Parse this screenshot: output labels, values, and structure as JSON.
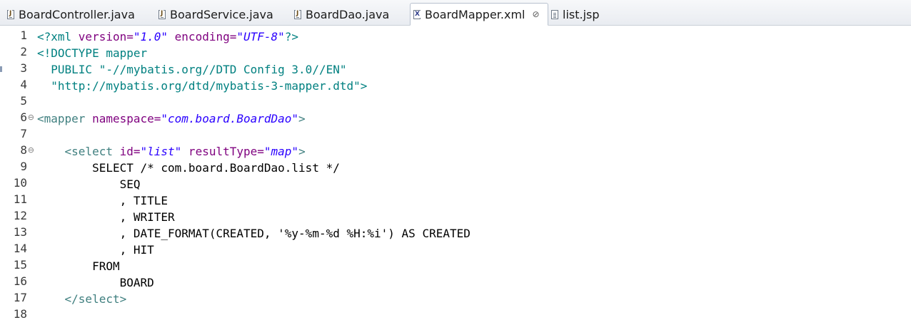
{
  "tabs": [
    {
      "label": "BoardController.java",
      "icon": "java-file-icon",
      "active": false
    },
    {
      "label": "BoardService.java",
      "icon": "java-file-icon",
      "active": false
    },
    {
      "label": "BoardDao.java",
      "icon": "java-file-icon",
      "active": false
    },
    {
      "label": "BoardMapper.xml",
      "icon": "xml-file-icon",
      "active": true,
      "close": "⊘"
    },
    {
      "label": "list.jsp",
      "icon": "jsp-file-icon",
      "active": false
    }
  ],
  "editor": {
    "line_numbers": [
      "1",
      "2",
      "3",
      "4",
      "5",
      "6",
      "7",
      "8",
      "9",
      "10",
      "11",
      "12",
      "13",
      "14",
      "15",
      "16",
      "17",
      "18"
    ],
    "fold_marker": "⊖",
    "lines": [
      [
        {
          "t": "<?xml ",
          "c": "decl"
        },
        {
          "t": "version=",
          "c": "attr"
        },
        {
          "t": "\"1.0\"",
          "c": "value"
        },
        {
          "t": " encoding=",
          "c": "attr"
        },
        {
          "t": "\"UTF-8\"",
          "c": "value"
        },
        {
          "t": "?>",
          "c": "decl"
        }
      ],
      [
        {
          "t": "<!DOCTYPE mapper",
          "c": "doctype"
        }
      ],
      [
        {
          "t": "  PUBLIC \"-//mybatis.org//DTD Config 3.0//EN\"",
          "c": "doctype"
        }
      ],
      [
        {
          "t": "  \"http://mybatis.org/dtd/mybatis-3-mapper.dtd\">",
          "c": "doctype"
        }
      ],
      [],
      [
        {
          "t": "<mapper ",
          "c": "tag"
        },
        {
          "t": "namespace=",
          "c": "attr"
        },
        {
          "t": "\"com.board.BoardDao\"",
          "c": "value"
        },
        {
          "t": ">",
          "c": "tag"
        }
      ],
      [],
      [
        {
          "t": "    <select ",
          "c": "tag"
        },
        {
          "t": "id=",
          "c": "attr"
        },
        {
          "t": "\"list\"",
          "c": "value"
        },
        {
          "t": " resultType=",
          "c": "attr"
        },
        {
          "t": "\"map\"",
          "c": "value"
        },
        {
          "t": ">",
          "c": "tag"
        }
      ],
      [
        {
          "t": "        SELECT /* com.board.BoardDao.list */",
          "c": "plain"
        }
      ],
      [
        {
          "t": "            SEQ",
          "c": "plain"
        }
      ],
      [
        {
          "t": "            , TITLE",
          "c": "plain"
        }
      ],
      [
        {
          "t": "            , WRITER",
          "c": "plain"
        }
      ],
      [
        {
          "t": "            , DATE_FORMAT(CREATED, '%y-%m-%d %H:%i') AS CREATED",
          "c": "plain"
        }
      ],
      [
        {
          "t": "            , HIT",
          "c": "plain"
        }
      ],
      [
        {
          "t": "        FROM",
          "c": "plain"
        }
      ],
      [
        {
          "t": "            BOARD",
          "c": "plain"
        }
      ],
      [
        {
          "t": "    </select>",
          "c": "tag"
        }
      ],
      []
    ]
  },
  "colors": {
    "decl": "#008080",
    "tag": "#3f7f7f",
    "attr": "#7f007f",
    "value": "#2a00ff",
    "plain": "#000000"
  }
}
